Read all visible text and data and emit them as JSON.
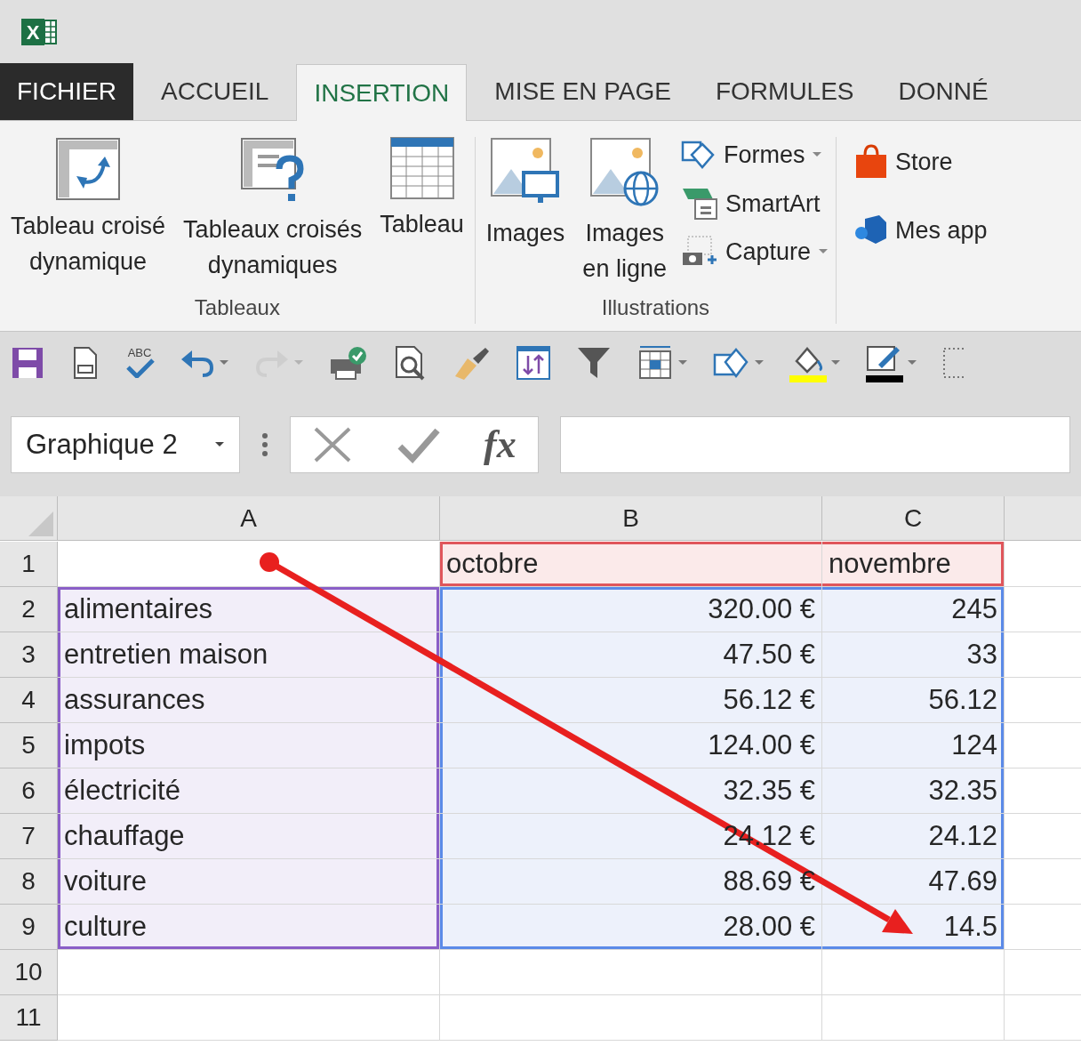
{
  "app_logo": {
    "letter": "X"
  },
  "tabs": [
    {
      "label": "FICHIER",
      "kind": "file",
      "selected": false
    },
    {
      "label": "ACCUEIL",
      "kind": "tab",
      "selected": false
    },
    {
      "label": "INSERTION",
      "kind": "tab",
      "selected": true
    },
    {
      "label": "MISE EN PAGE",
      "kind": "tab",
      "selected": false
    },
    {
      "label": "FORMULES",
      "kind": "tab",
      "selected": false
    },
    {
      "label": "DONNÉ",
      "kind": "tab",
      "selected": false
    }
  ],
  "ribbon": [
    {
      "label": "Tableaux",
      "big": [
        {
          "kind": "pivot",
          "label": "Tableau croisé\ndynamique"
        },
        {
          "kind": "pivot-suggest",
          "label": "Tableaux croisés\ndynamiques"
        },
        {
          "kind": "table",
          "label": "Tableau"
        }
      ]
    },
    {
      "label": "Illustrations",
      "big": [
        {
          "kind": "images",
          "label": "Images"
        },
        {
          "kind": "online-images",
          "label": "Images\nen ligne"
        }
      ],
      "small": [
        {
          "kind": "shapes",
          "label": "Formes",
          "dropdown": true
        },
        {
          "kind": "smartart",
          "label": "SmartArt",
          "dropdown": false
        },
        {
          "kind": "capture",
          "label": "Capture",
          "dropdown": true
        }
      ]
    },
    {
      "small": [
        {
          "kind": "store",
          "label": "Store",
          "dropdown": false
        },
        {
          "kind": "apps",
          "label": "Mes app",
          "dropdown": false
        }
      ]
    }
  ],
  "quick_access": [
    {
      "kind": "save",
      "dropdown": false,
      "disabled": false
    },
    {
      "kind": "preview",
      "dropdown": false,
      "disabled": false
    },
    {
      "kind": "spelling",
      "text": "ABC",
      "dropdown": false,
      "disabled": false
    },
    {
      "kind": "undo",
      "dropdown": true,
      "disabled": false
    },
    {
      "kind": "redo",
      "dropdown": true,
      "disabled": true
    },
    {
      "kind": "print",
      "dropdown": false,
      "disabled": false
    },
    {
      "kind": "zoom",
      "dropdown": false,
      "disabled": false
    },
    {
      "kind": "brush",
      "dropdown": false,
      "disabled": false
    },
    {
      "kind": "sort",
      "dropdown": false,
      "disabled": false
    },
    {
      "kind": "filter",
      "dropdown": false,
      "disabled": false
    },
    {
      "kind": "grid",
      "dropdown": true,
      "disabled": false
    },
    {
      "kind": "shapes",
      "dropdown": true,
      "disabled": false
    },
    {
      "kind": "fill",
      "dropdown": true,
      "disabled": false
    },
    {
      "kind": "pen",
      "dropdown": true,
      "disabled": false
    },
    {
      "kind": "more",
      "dropdown": false,
      "disabled": false
    }
  ],
  "formula_bar": {
    "name_box": "Graphique 2",
    "fx": "fx"
  },
  "sheet": {
    "columns": [
      "A",
      "B",
      "C"
    ],
    "rows": [
      {
        "num": "1",
        "cells": [
          {
            "kind": "plain"
          },
          {
            "text": "octobre",
            "kind": "series"
          },
          {
            "text": "novembre",
            "kind": "series"
          }
        ]
      },
      {
        "num": "2",
        "cells": [
          {
            "text": "alimentaires",
            "kind": "category"
          },
          {
            "text": "320.00 €",
            "kind": "values"
          },
          {
            "text": "245",
            "kind": "values"
          }
        ]
      },
      {
        "num": "3",
        "cells": [
          {
            "text": "entretien maison",
            "kind": "category"
          },
          {
            "text": "47.50 €",
            "kind": "values"
          },
          {
            "text": "33",
            "kind": "values"
          }
        ]
      },
      {
        "num": "4",
        "cells": [
          {
            "text": "assurances",
            "kind": "category"
          },
          {
            "text": "56.12 €",
            "kind": "values"
          },
          {
            "text": "56.12",
            "kind": "values"
          }
        ]
      },
      {
        "num": "5",
        "cells": [
          {
            "text": "impots",
            "kind": "category"
          },
          {
            "text": "124.00 €",
            "kind": "values"
          },
          {
            "text": "124",
            "kind": "values"
          }
        ]
      },
      {
        "num": "6",
        "cells": [
          {
            "text": "électricité",
            "kind": "category"
          },
          {
            "text": "32.35 €",
            "kind": "values"
          },
          {
            "text": "32.35",
            "kind": "values"
          }
        ]
      },
      {
        "num": "7",
        "cells": [
          {
            "text": "chauffage",
            "kind": "category"
          },
          {
            "text": "24.12 €",
            "kind": "values"
          },
          {
            "text": "24.12",
            "kind": "values"
          }
        ]
      },
      {
        "num": "8",
        "cells": [
          {
            "text": "voiture",
            "kind": "category"
          },
          {
            "text": "88.69 €",
            "kind": "values"
          },
          {
            "text": "47.69",
            "kind": "values"
          }
        ]
      },
      {
        "num": "9",
        "cells": [
          {
            "text": "culture",
            "kind": "category"
          },
          {
            "text": "28.00 €",
            "kind": "values"
          },
          {
            "text": "14.5",
            "kind": "values"
          }
        ]
      },
      {
        "num": "10",
        "cells": [
          {
            "kind": "plain"
          },
          {
            "kind": "plain"
          },
          {
            "kind": "plain"
          }
        ]
      },
      {
        "num": "11",
        "cells": [
          {
            "kind": "plain"
          },
          {
            "kind": "plain"
          },
          {
            "kind": "plain"
          }
        ]
      }
    ]
  }
}
